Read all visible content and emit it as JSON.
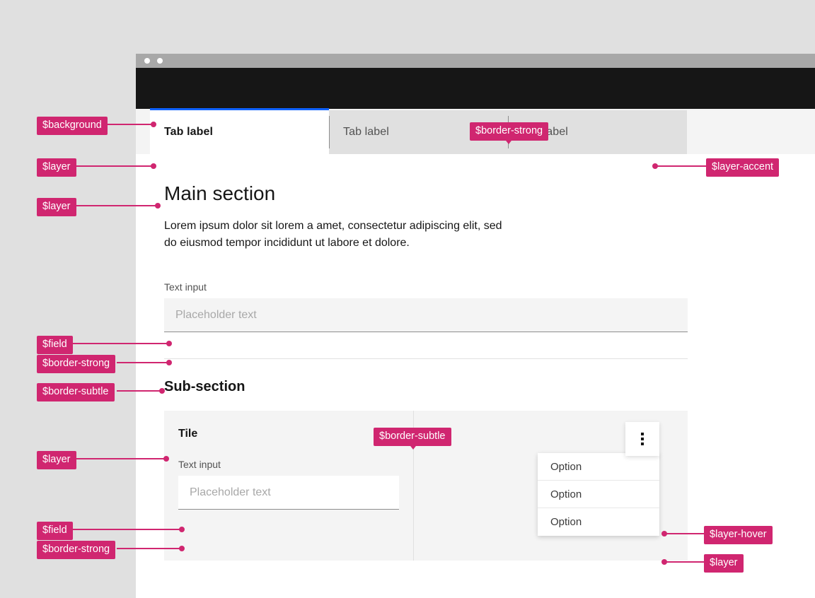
{
  "page": {
    "background_color": "#e0e0e0",
    "accent_color": "#d02670",
    "active_tab_indicator_color": "#0f62fe"
  },
  "window": {
    "titlebar_dots": 2,
    "header_bar_color": "#161616"
  },
  "tabs": [
    {
      "label": "Tab label",
      "active": true
    },
    {
      "label": "Tab label",
      "active": false
    },
    {
      "label": "Tab label",
      "active": false
    }
  ],
  "main": {
    "heading": "Main section",
    "paragraph": "Lorem ipsum dolor sit lorem a amet, consectetur adipiscing elit, sed do eiusmod tempor incididunt ut labore et dolore.",
    "text_input": {
      "label": "Text input",
      "placeholder": "Placeholder text",
      "value": ""
    },
    "subheading": "Sub-section"
  },
  "tile": {
    "title": "Tile",
    "text_input": {
      "label": "Text input",
      "placeholder": "Placeholder text",
      "value": ""
    }
  },
  "overflow_menu": {
    "button_icon": "overflow-vertical-icon",
    "items": [
      {
        "label": "Option",
        "state": "default"
      },
      {
        "label": "Option",
        "state": "hover"
      },
      {
        "label": "Option",
        "state": "default"
      }
    ]
  },
  "annotations": [
    {
      "id": "background",
      "label": "$background"
    },
    {
      "id": "layer-tab",
      "label": "$layer"
    },
    {
      "id": "layer-panel",
      "label": "$layer"
    },
    {
      "id": "border-strong-tabs",
      "label": "$border-strong"
    },
    {
      "id": "layer-accent",
      "label": "$layer-accent"
    },
    {
      "id": "field-main",
      "label": "$field"
    },
    {
      "id": "border-strong-input",
      "label": "$border-strong"
    },
    {
      "id": "border-subtle-divider",
      "label": "$border-subtle"
    },
    {
      "id": "border-subtle-tile",
      "label": "$border-subtle"
    },
    {
      "id": "layer-tile",
      "label": "$layer"
    },
    {
      "id": "field-tile",
      "label": "$field"
    },
    {
      "id": "border-strong-tile-input",
      "label": "$border-strong"
    },
    {
      "id": "layer-hover-menu",
      "label": "$layer-hover"
    },
    {
      "id": "layer-menu",
      "label": "$layer"
    }
  ]
}
